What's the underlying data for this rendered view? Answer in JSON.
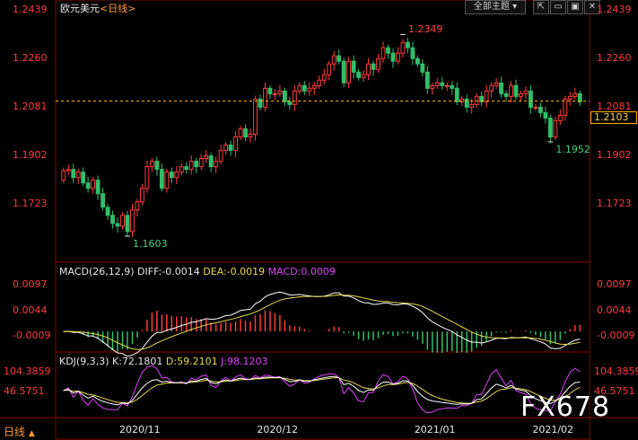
{
  "header": {
    "title": "欧元美元",
    "period": "<日线>",
    "theme_button": "全部主题",
    "buttons": [
      "full-icon",
      "minimize-icon",
      "maximize-icon",
      "close-icon"
    ]
  },
  "bottom": {
    "period_tab": "日线",
    "period_arrow": "▲"
  },
  "watermark": "FX678",
  "colors": {
    "up": "#ff3b3b",
    "down": "#2fbf6a",
    "diff": "#ffffff",
    "dea": "#e6d84a",
    "macd_label": "#e040fb",
    "j": "#e040fb"
  },
  "chart_data": [
    {
      "type": "candlestick",
      "ylim": [
        1.152,
        1.245
      ],
      "y_ticks": [
        "1.2439",
        "1.2260",
        "1.2081",
        "1.1902",
        "1.1723"
      ],
      "last_price": "1.2103",
      "last_price_value": 1.2103,
      "annotations": [
        {
          "text": "1.2349",
          "value": 1.2349,
          "index": 69
        },
        {
          "text": "1.1603",
          "value": 1.1603,
          "index": 13
        },
        {
          "text": "1.1952",
          "value": 1.1952,
          "index": 99
        }
      ],
      "x_labels": [
        {
          "text": "2020/11",
          "index": 15
        },
        {
          "text": "2020/12",
          "index": 43
        },
        {
          "text": "2021/01",
          "index": 75
        },
        {
          "text": "2021/02",
          "index": 99
        }
      ],
      "closes": [
        1.1845,
        1.185,
        1.182,
        1.184,
        1.18,
        1.178,
        1.181,
        1.176,
        1.171,
        1.168,
        1.165,
        1.164,
        1.168,
        1.162,
        1.17,
        1.173,
        1.178,
        1.186,
        1.188,
        1.185,
        1.178,
        1.184,
        1.182,
        1.184,
        1.186,
        1.185,
        1.188,
        1.186,
        1.189,
        1.19,
        1.186,
        1.188,
        1.192,
        1.194,
        1.192,
        1.197,
        1.2,
        1.197,
        1.198,
        1.211,
        1.208,
        1.215,
        1.213,
        1.213,
        1.214,
        1.21,
        1.209,
        1.214,
        1.216,
        1.214,
        1.215,
        1.216,
        1.218,
        1.22,
        1.224,
        1.227,
        1.225,
        1.217,
        1.225,
        1.221,
        1.219,
        1.22,
        1.224,
        1.222,
        1.226,
        1.23,
        1.228,
        1.225,
        1.228,
        1.232,
        1.23,
        1.226,
        1.224,
        1.221,
        1.215,
        1.216,
        1.217,
        1.216,
        1.216,
        1.215,
        1.21,
        1.211,
        1.208,
        1.209,
        1.212,
        1.21,
        1.214,
        1.216,
        1.217,
        1.213,
        1.212,
        1.216,
        1.212,
        1.213,
        1.214,
        1.208,
        1.208,
        1.206,
        1.204,
        1.197,
        1.203,
        1.205,
        1.211,
        1.212,
        1.213,
        1.21
      ],
      "opens": [
        1.181,
        1.1845,
        1.185,
        1.182,
        1.184,
        1.18,
        1.178,
        1.181,
        1.176,
        1.171,
        1.168,
        1.165,
        1.164,
        1.168,
        1.162,
        1.17,
        1.173,
        1.178,
        1.186,
        1.188,
        1.185,
        1.178,
        1.184,
        1.182,
        1.184,
        1.186,
        1.185,
        1.188,
        1.186,
        1.189,
        1.19,
        1.186,
        1.188,
        1.192,
        1.194,
        1.192,
        1.197,
        1.2,
        1.197,
        1.198,
        1.211,
        1.208,
        1.215,
        1.213,
        1.213,
        1.214,
        1.21,
        1.209,
        1.214,
        1.216,
        1.214,
        1.215,
        1.216,
        1.218,
        1.22,
        1.224,
        1.227,
        1.225,
        1.217,
        1.225,
        1.221,
        1.219,
        1.22,
        1.224,
        1.222,
        1.226,
        1.23,
        1.228,
        1.225,
        1.228,
        1.232,
        1.23,
        1.226,
        1.224,
        1.221,
        1.215,
        1.216,
        1.217,
        1.216,
        1.216,
        1.215,
        1.21,
        1.211,
        1.208,
        1.209,
        1.212,
        1.21,
        1.214,
        1.216,
        1.217,
        1.213,
        1.212,
        1.216,
        1.212,
        1.213,
        1.214,
        1.208,
        1.208,
        1.206,
        1.204,
        1.197,
        1.203,
        1.205,
        1.211,
        1.212,
        1.213
      ]
    },
    {
      "type": "line",
      "name": "MACD(26,12,9)",
      "diff_label": "DIFF:-0.0014",
      "dea_label": "DEA:-0.0019",
      "macd_label": "MACD:0.0009",
      "ylim": [
        -0.0035,
        0.011
      ],
      "y_ticks": [
        "0.0097",
        "0.0044",
        "-0.0009"
      ]
    },
    {
      "type": "line",
      "name": "KDJ(9,3,3)",
      "k_label": "K:72.1801",
      "d_label": "D:59.2101",
      "j_label": "J:98.1203",
      "ylim": [
        -20,
        130
      ],
      "y_ticks": [
        "104.3859",
        "46.5751"
      ]
    }
  ]
}
